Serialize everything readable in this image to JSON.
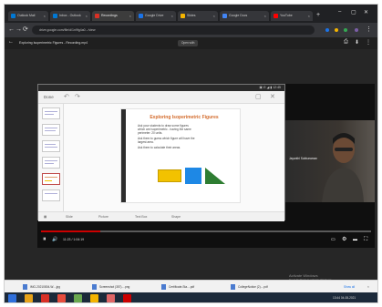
{
  "browser": {
    "tabs": [
      {
        "label": "Outlook Mail",
        "color": "#0078d4"
      },
      {
        "label": "Inbox - Outlook",
        "color": "#0078d4"
      },
      {
        "label": "Recordings",
        "color": "#d93025",
        "active": true
      },
      {
        "label": "Google Drive",
        "color": "#1a73e8"
      },
      {
        "label": "Slides",
        "color": "#f4b400"
      },
      {
        "label": "Google Docs",
        "color": "#4285f4"
      },
      {
        "label": "YouTube",
        "color": "#ff0000"
      }
    ],
    "new_tab": "+",
    "address": "drive.google.com/file/d/1n9fg4a0.../view",
    "nav": {
      "back": "←",
      "forward": "→",
      "reload": "⟳"
    }
  },
  "preview": {
    "filename": "Exploring Isoperimetric Figures - Recording.mp4",
    "open_with": "Open with"
  },
  "slide_app": {
    "done_label": "Done",
    "slide": {
      "title": "Exploring Isoperimetric Figures",
      "lines": [
        "Ask your students to draw some figures",
        "which are isoperimetric - having the same",
        "perimeter: 20 units.",
        "Ask them to guess which figure will have the",
        "largest area.",
        "Ask them to calculate their areas."
      ],
      "shape_colors": [
        "#f2c200",
        "#1e88e5",
        "#2e7d32"
      ]
    },
    "bottom_tools": [
      "Slide",
      "Picture",
      "Text Box",
      "Shape"
    ]
  },
  "webcam": {
    "name": "Jayanthi Subbaraman"
  },
  "player": {
    "progress": 0.18,
    "play_icon": "⏸",
    "volume_icon": "🔊",
    "timecode": "11:23 / 1:04:19",
    "settings_icon": "⚙",
    "fullscreen_icon": "⛶"
  },
  "watermark": {
    "line1": "Activate Windows",
    "line2": "Go to Settings to activate Windows."
  },
  "downloads": [
    "IMG-20210804-W....jpg",
    "Screenshot (357)....png",
    "Certificate-Sta....pdf",
    "CollegeNotice (2)....pdf"
  ],
  "show_all": "Show all",
  "taskbar": {
    "icons": [
      "#2f6fdb",
      "#e8a319",
      "#d93025",
      "#e74c3c",
      "#6aa84f",
      "#f4b400",
      "#e06666",
      "#cc0000"
    ],
    "clock": "13:44  04-08-2021"
  }
}
